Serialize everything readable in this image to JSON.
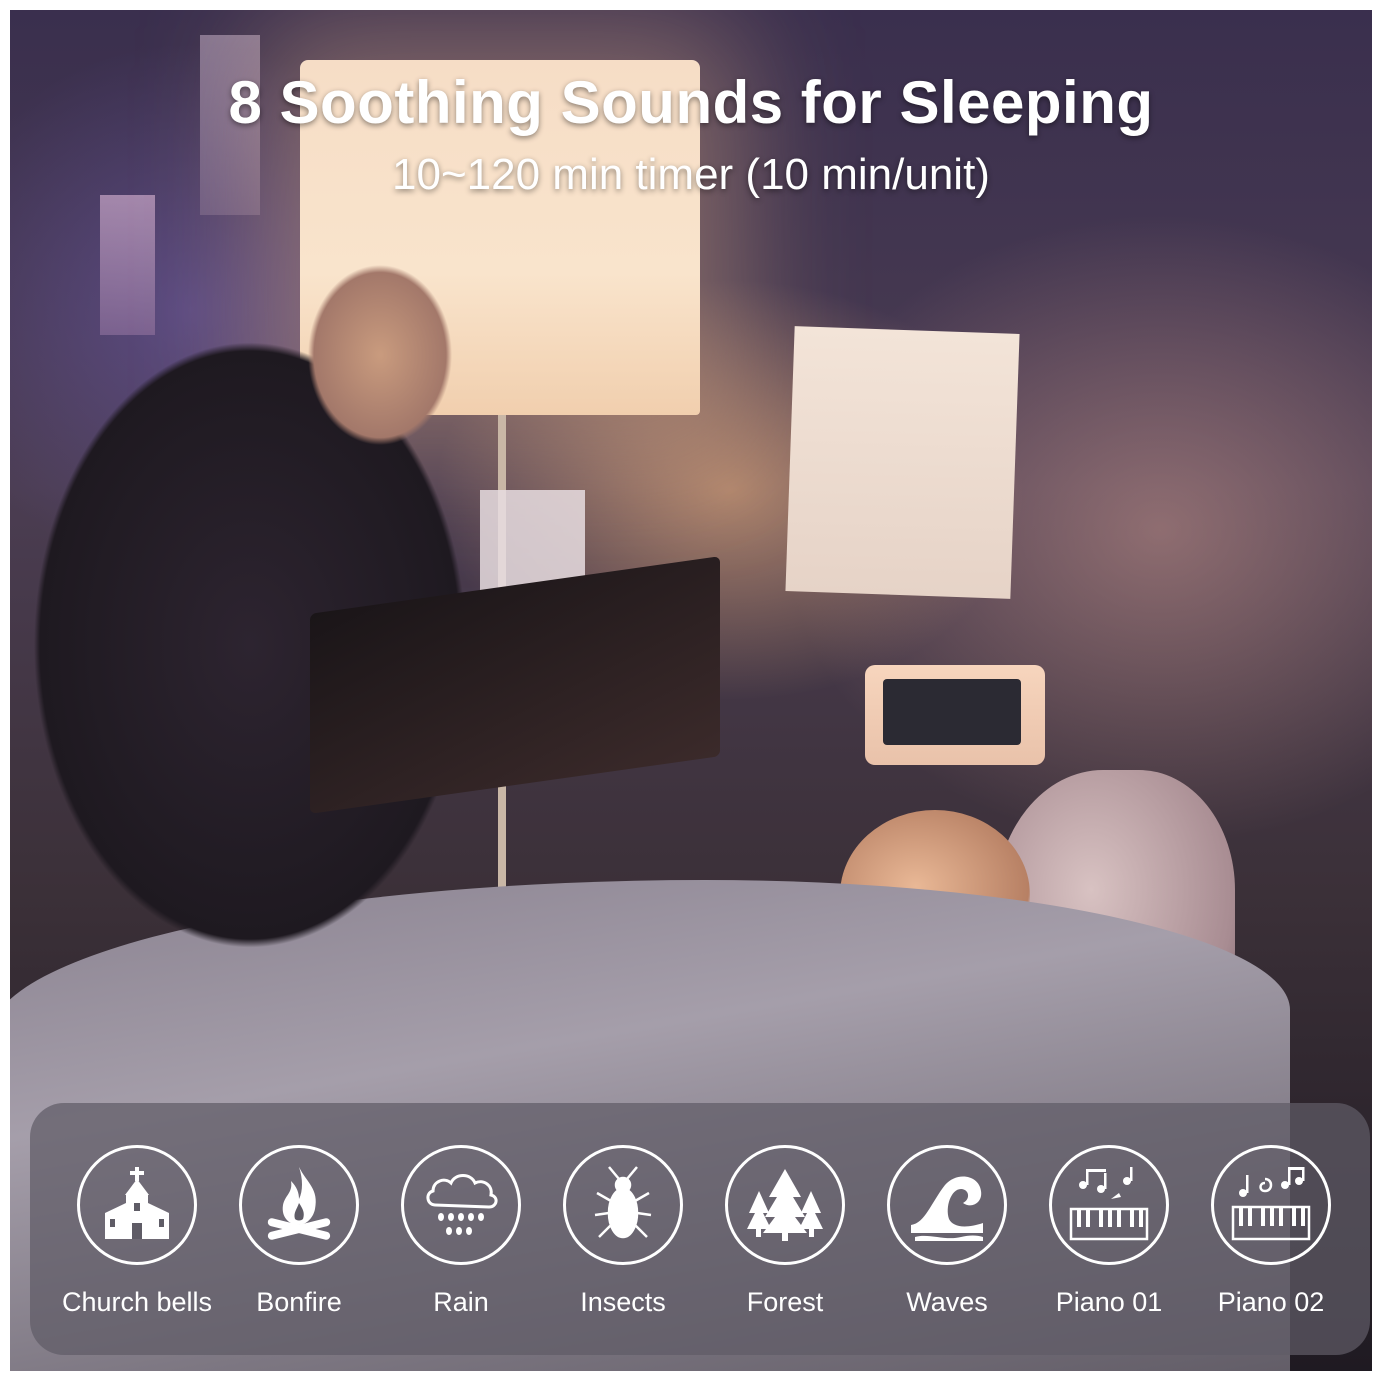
{
  "headline": "8 Soothing Sounds for Sleeping",
  "subline": "10~120 min timer (10 min/unit)",
  "sounds": [
    {
      "label": "Church bells",
      "icon": "church-icon"
    },
    {
      "label": "Bonfire",
      "icon": "bonfire-icon"
    },
    {
      "label": "Rain",
      "icon": "rain-cloud-icon"
    },
    {
      "label": "Insects",
      "icon": "insect-icon"
    },
    {
      "label": "Forest",
      "icon": "forest-icon"
    },
    {
      "label": "Waves",
      "icon": "wave-icon"
    },
    {
      "label": "Piano 01",
      "icon": "piano-notes-icon"
    },
    {
      "label": "Piano 02",
      "icon": "piano-notes-icon"
    }
  ],
  "colors": {
    "text": "#ffffff",
    "panel": "#5f5c66"
  }
}
